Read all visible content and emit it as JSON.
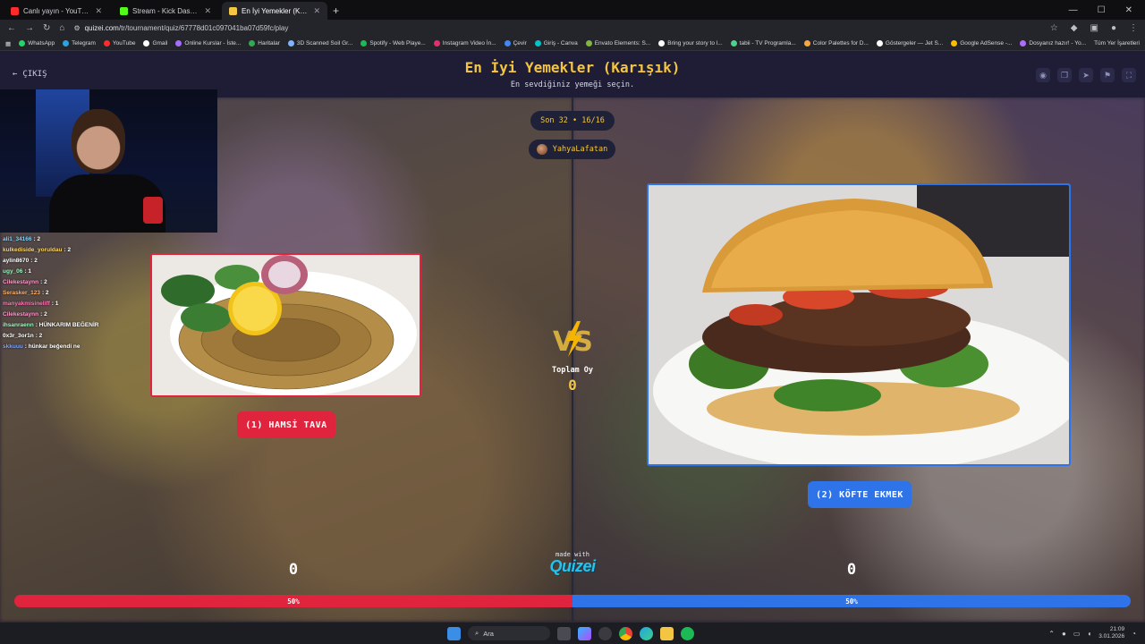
{
  "browser": {
    "tabs": [
      {
        "title": "Canlı yayın - YouTube Studio",
        "color": "#ff2b2b",
        "active": false
      },
      {
        "title": "Stream - Kick Dashboard",
        "color": "#53fc18",
        "active": false
      },
      {
        "title": "En İyi Yemekler (Karışık) - Tier l",
        "color": "#f4c542",
        "active": true
      }
    ],
    "new_tab": "+",
    "url_domain": "quizei.com",
    "url_path": "/tr/tournament/quiz/67778d01c097041ba07d59fc/play",
    "bookmarks": [
      {
        "label": "WhatsApp",
        "color": "#25d366"
      },
      {
        "label": "Telegram",
        "color": "#2aa3e0"
      },
      {
        "label": "YouTube",
        "color": "#ff2b2b"
      },
      {
        "label": "Gmail",
        "color": "#ffffff"
      },
      {
        "label": "Online Kurslar - İste...",
        "color": "#a66cff"
      },
      {
        "label": "Haritalar",
        "color": "#34a853"
      },
      {
        "label": "3D Scanned Soil Gr...",
        "color": "#7fb4ff"
      },
      {
        "label": "Spotify - Web Playe...",
        "color": "#1db954"
      },
      {
        "label": "Instagram Video İn...",
        "color": "#e1306c"
      },
      {
        "label": "Çevir",
        "color": "#4285f4"
      },
      {
        "label": "Giriş - Canva",
        "color": "#00c4cc"
      },
      {
        "label": "Envato Elements: S...",
        "color": "#82b541"
      },
      {
        "label": "Bring your story to l...",
        "color": "#ffffff"
      },
      {
        "label": "tabii - TV Programla...",
        "color": "#4fd18b"
      },
      {
        "label": "Color Palettes for D...",
        "color": "#f4a742"
      },
      {
        "label": "Göstergeler — Jet S...",
        "color": "#ffffff"
      },
      {
        "label": "Google AdSense -...",
        "color": "#fbbc04"
      },
      {
        "label": "Dosyanız hazır! - Yo...",
        "color": "#b06cff"
      }
    ],
    "bookmarks_all": "Tüm Yer İşaretleri"
  },
  "header": {
    "exit_label": "ÇIKIŞ",
    "title": "En İyi Yemekler (Karışık)",
    "subtitle": "En sevdiğiniz yemeği seçin.",
    "icons": [
      "eye-icon",
      "copy-icon",
      "send-icon",
      "flag-icon",
      "fullscreen-icon"
    ]
  },
  "round": {
    "label": "Son 32 • 16/16",
    "user": "YahyaLafatan"
  },
  "chat": [
    {
      "user": "ali1_34166",
      "msg": ": 2",
      "color": "#7fd7ff"
    },
    {
      "user": "kulkediside_yoruldau",
      "msg": ": 2",
      "color": "#ffd86b"
    },
    {
      "user": "aylin8670",
      "msg": ": 2",
      "color": "#ffffff"
    },
    {
      "user": "ugy_06",
      "msg": ": 1",
      "color": "#9ef7c1"
    },
    {
      "user": "Cilekestaynn",
      "msg": ": 2",
      "color": "#ff9acb"
    },
    {
      "user": "Serasker_123",
      "msg": ": 2",
      "color": "#ffb36b"
    },
    {
      "user": "manyakmisineliff",
      "msg": ": 1",
      "color": "#ff7ab8"
    },
    {
      "user": "Cilekestaynn",
      "msg": ": 2",
      "color": "#ff9acb"
    },
    {
      "user": "ihsanraenn",
      "msg": ": HÜNKARIM BEĞENİR",
      "color": "#9ef7c1"
    },
    {
      "user": "0x3r_3or1n",
      "msg": ": 2",
      "color": "#ffffff"
    },
    {
      "user": "skkuuu",
      "msg": ": hünkar beğendi ne",
      "color": "#7fa8ff"
    }
  ],
  "left": {
    "button_label": "(1) HAMSİ TAVA",
    "score": "0",
    "percent": "50%",
    "color": "#e0243d"
  },
  "right": {
    "button_label": "(2) KÖFTE EKMEK",
    "score": "0",
    "percent": "50%",
    "color": "#2f73e8"
  },
  "center": {
    "total_label": "Toplam Oy",
    "total_value": "0"
  },
  "footer": {
    "made_with": "made with",
    "logo": "Quizei"
  },
  "taskbar": {
    "search_label": "Ara",
    "time": "21:09",
    "date": "3.01.2026"
  }
}
